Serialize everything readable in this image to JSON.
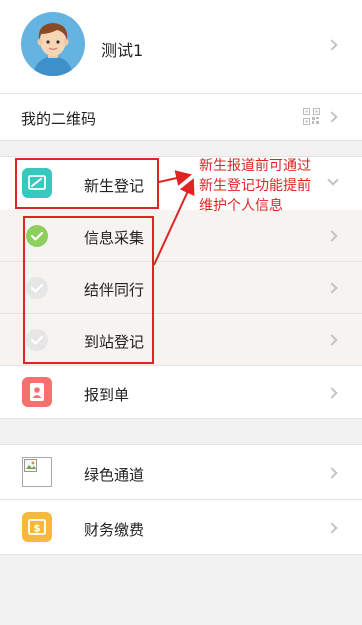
{
  "profile": {
    "name": "测试1"
  },
  "qrcode": {
    "label": "我的二维码"
  },
  "registration": {
    "label": "新生登记",
    "steps": [
      {
        "label": "信息采集",
        "done": true
      },
      {
        "label": "结伴同行",
        "done": false
      },
      {
        "label": "到站登记",
        "done": false
      }
    ]
  },
  "report": {
    "label": "报到单"
  },
  "green_channel": {
    "label": "绿色通道"
  },
  "finance": {
    "label": "财务缴费"
  },
  "annotation": {
    "lines": [
      "新生报道前可通过",
      "新生登记功能提前",
      "维护个人信息"
    ]
  },
  "colors": {
    "registration_icon": "#37c8c0",
    "report_icon": "#f76f6f",
    "finance_icon": "#f6b93b",
    "check_done": "#8ccf5c",
    "check_todo": "#e6e6e6",
    "annotation": "#e02424"
  }
}
